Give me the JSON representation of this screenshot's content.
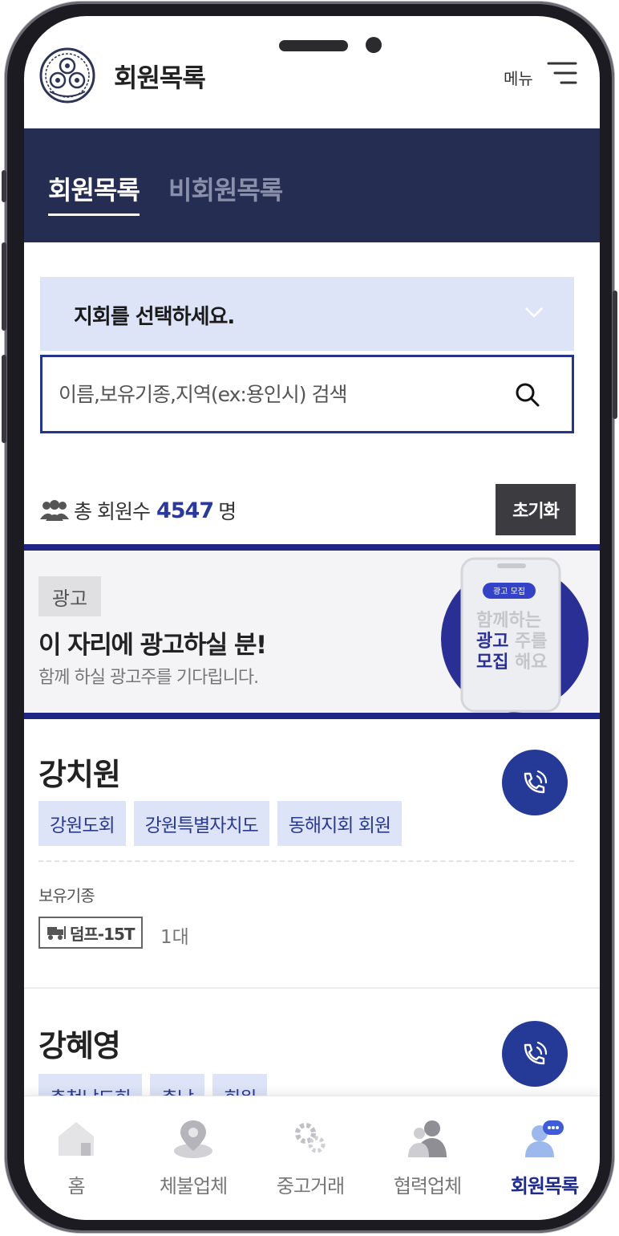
{
  "header": {
    "title": "회원목록",
    "menu_label": "메뉴"
  },
  "tabs": [
    {
      "label": "회원목록",
      "active": true
    },
    {
      "label": "비회원목록",
      "active": false
    }
  ],
  "branch_select": {
    "value": "지회를 선택하세요."
  },
  "search": {
    "placeholder": "이름,보유기종,지역(ex:용인시) 검색"
  },
  "summary": {
    "prefix": "총 회원수",
    "count": "4547",
    "unit": "명",
    "reset_label": "초기화"
  },
  "ad": {
    "badge": "광고",
    "title": "이 자리에 광고하실 분!",
    "subtitle": "함께 하실 광고주를 기다립니다.",
    "graphic_chip": "광고 모집",
    "graphic_line1": "함께하는",
    "graphic_line2a": "광고",
    "graphic_line2b": "주를",
    "graphic_line3a": "모집",
    "graphic_line3b": "해요"
  },
  "members": [
    {
      "name": "강치원",
      "tags": [
        "강원도회",
        "강원특별자치도",
        "동해지회 회원"
      ],
      "equipment_label": "보유기종",
      "equipment": [
        {
          "name": "덤프-15T",
          "count": "1대"
        }
      ]
    },
    {
      "name": "강혜영",
      "tags": [
        "충청남도회",
        "충남",
        "회원"
      ]
    }
  ],
  "bottom_nav": [
    {
      "label": "홈",
      "icon": "home-icon",
      "active": false
    },
    {
      "label": "체불업체",
      "icon": "location-icon",
      "active": false
    },
    {
      "label": "중고거래",
      "icon": "gear-icon",
      "active": false
    },
    {
      "label": "협력업체",
      "icon": "partner-icon",
      "active": false
    },
    {
      "label": "회원목록",
      "icon": "member-chat-icon",
      "active": true
    }
  ],
  "colors": {
    "navy": "#252d52",
    "accent": "#253a96",
    "tag_bg": "#dde4f8",
    "ad_border": "#1e2584"
  }
}
